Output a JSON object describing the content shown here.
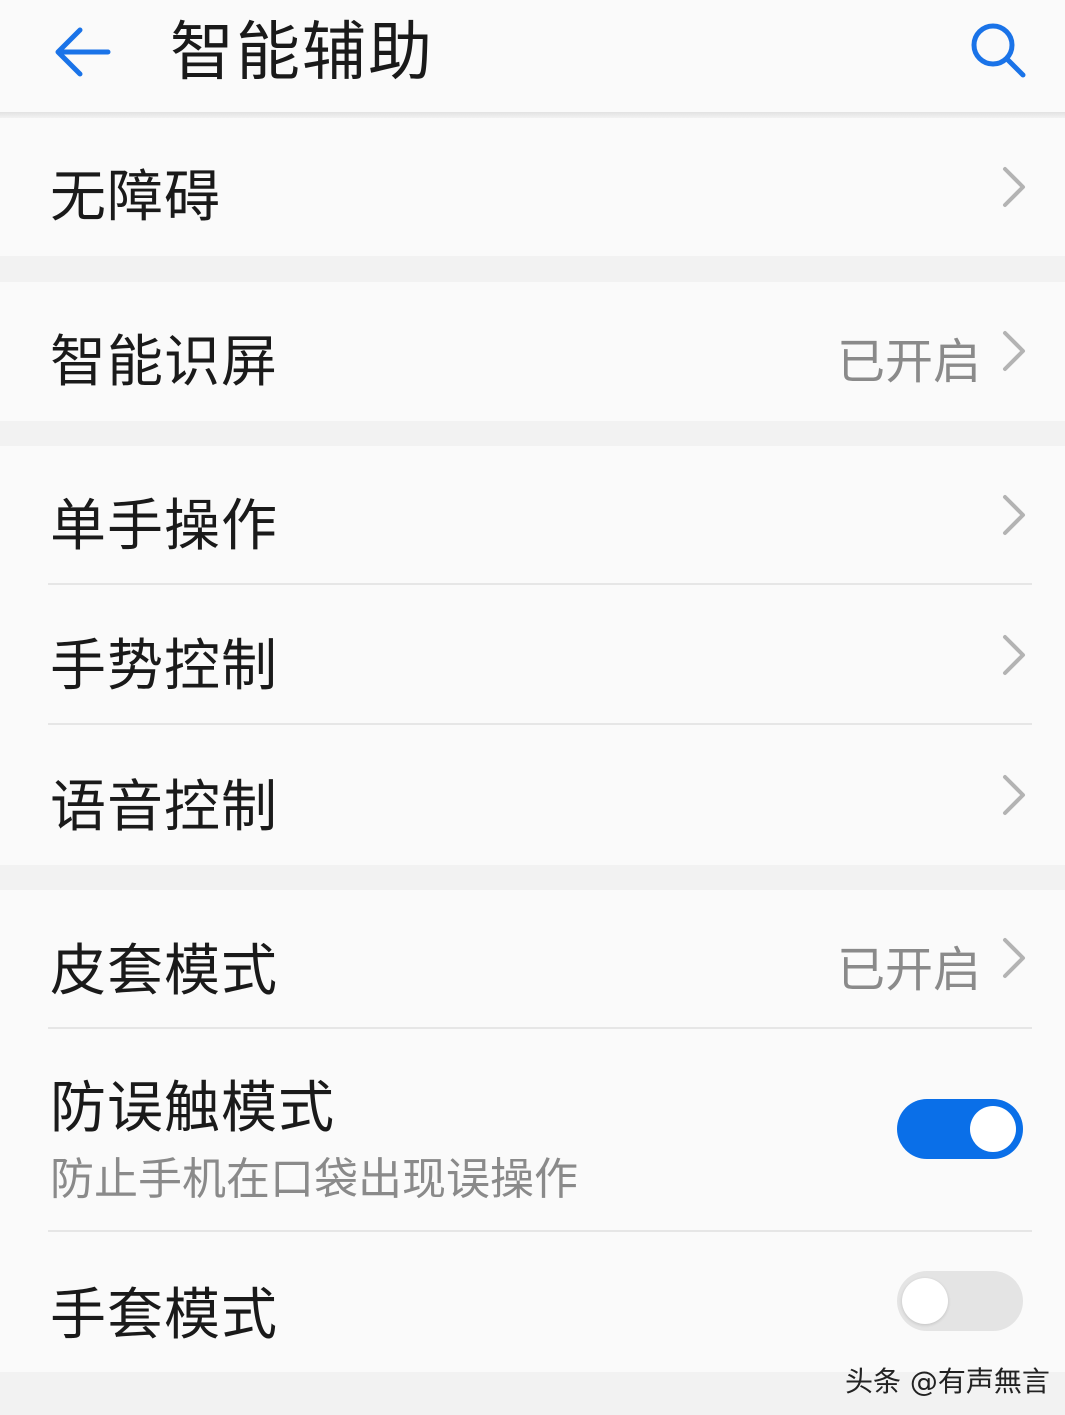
{
  "header": {
    "title": "智能辅助",
    "back_icon": "arrow-left-icon",
    "search_icon": "search-icon",
    "accent_color": "#1a73e8"
  },
  "groups": [
    {
      "items": [
        {
          "label": "无障碍",
          "value": "",
          "control": "chevron"
        }
      ]
    },
    {
      "items": [
        {
          "label": "智能识屏",
          "value": "已开启",
          "control": "chevron"
        }
      ]
    },
    {
      "items": [
        {
          "label": "单手操作",
          "value": "",
          "control": "chevron"
        },
        {
          "label": "手势控制",
          "value": "",
          "control": "chevron"
        },
        {
          "label": "语音控制",
          "value": "",
          "control": "chevron"
        }
      ]
    },
    {
      "items": [
        {
          "label": "皮套模式",
          "value": "已开启",
          "control": "chevron"
        },
        {
          "label": "防误触模式",
          "subtitle": "防止手机在口袋出现误操作",
          "control": "toggle",
          "state": "on"
        },
        {
          "label": "手套模式",
          "control": "toggle",
          "state": "off"
        }
      ]
    }
  ],
  "toggle_on_color": "#0a6fe8",
  "watermark": "头条 @有声無言"
}
